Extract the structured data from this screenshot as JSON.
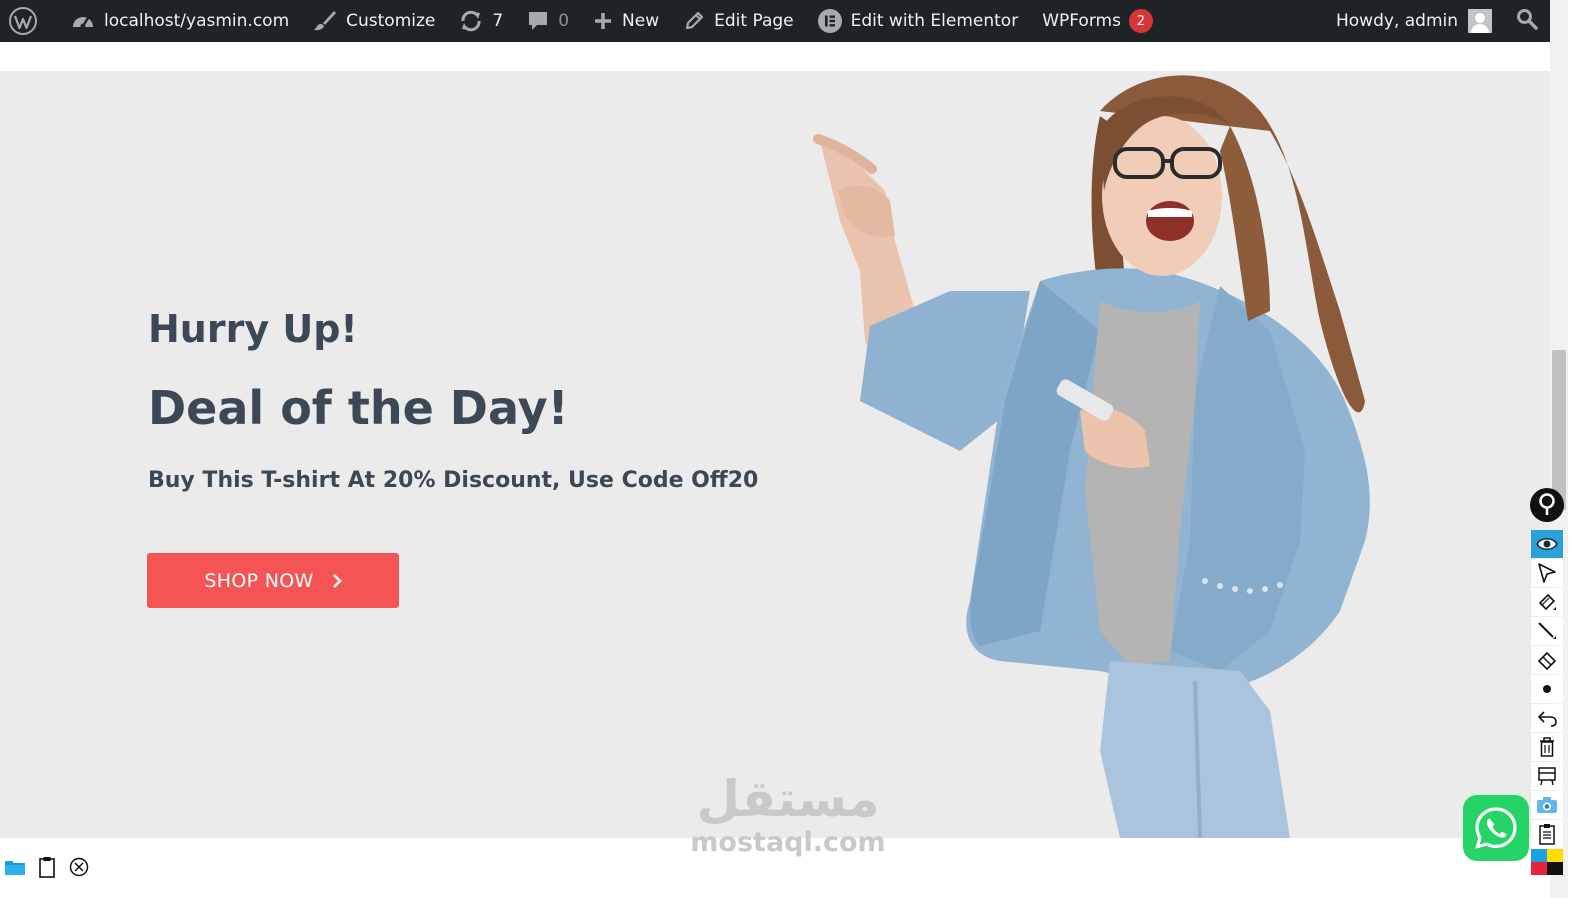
{
  "adminbar": {
    "site_label": "localhost/yasmin.com",
    "customize_label": "Customize",
    "updates_count": "7",
    "comments_count": "0",
    "new_label": "New",
    "edit_page_label": "Edit Page",
    "elementor_label": "Edit with Elementor",
    "wpforms_label": "WPForms",
    "wpforms_badge": "2",
    "howdy_label": "Howdy, admin"
  },
  "hero": {
    "title_small": "Hurry Up!",
    "title_big": "Deal of the Day!",
    "subtitle": "Buy This T-shirt At 20% Discount, Use Code Off20",
    "button_label": "SHOP NOW",
    "background": "#ebebeb",
    "button_color": "#f55454",
    "text_color": "#3d4857"
  },
  "watermark": {
    "arabic": "مستقل",
    "latin": "mostaql.com"
  },
  "toolbar": {
    "items": [
      "pin-icon",
      "eye-icon",
      "cursor-icon",
      "highlighter-icon",
      "pen-icon",
      "eraser-icon",
      "dot-icon",
      "undo-icon",
      "trash-icon",
      "board-icon",
      "camera-icon",
      "clipboard-icon",
      "color-palette-icon"
    ],
    "active": "eye-icon",
    "accent": "#2d9fd9"
  },
  "colors": {
    "adminbar_bg": "#1d2327",
    "badge": "#d63638",
    "whatsapp": "#25d366"
  }
}
